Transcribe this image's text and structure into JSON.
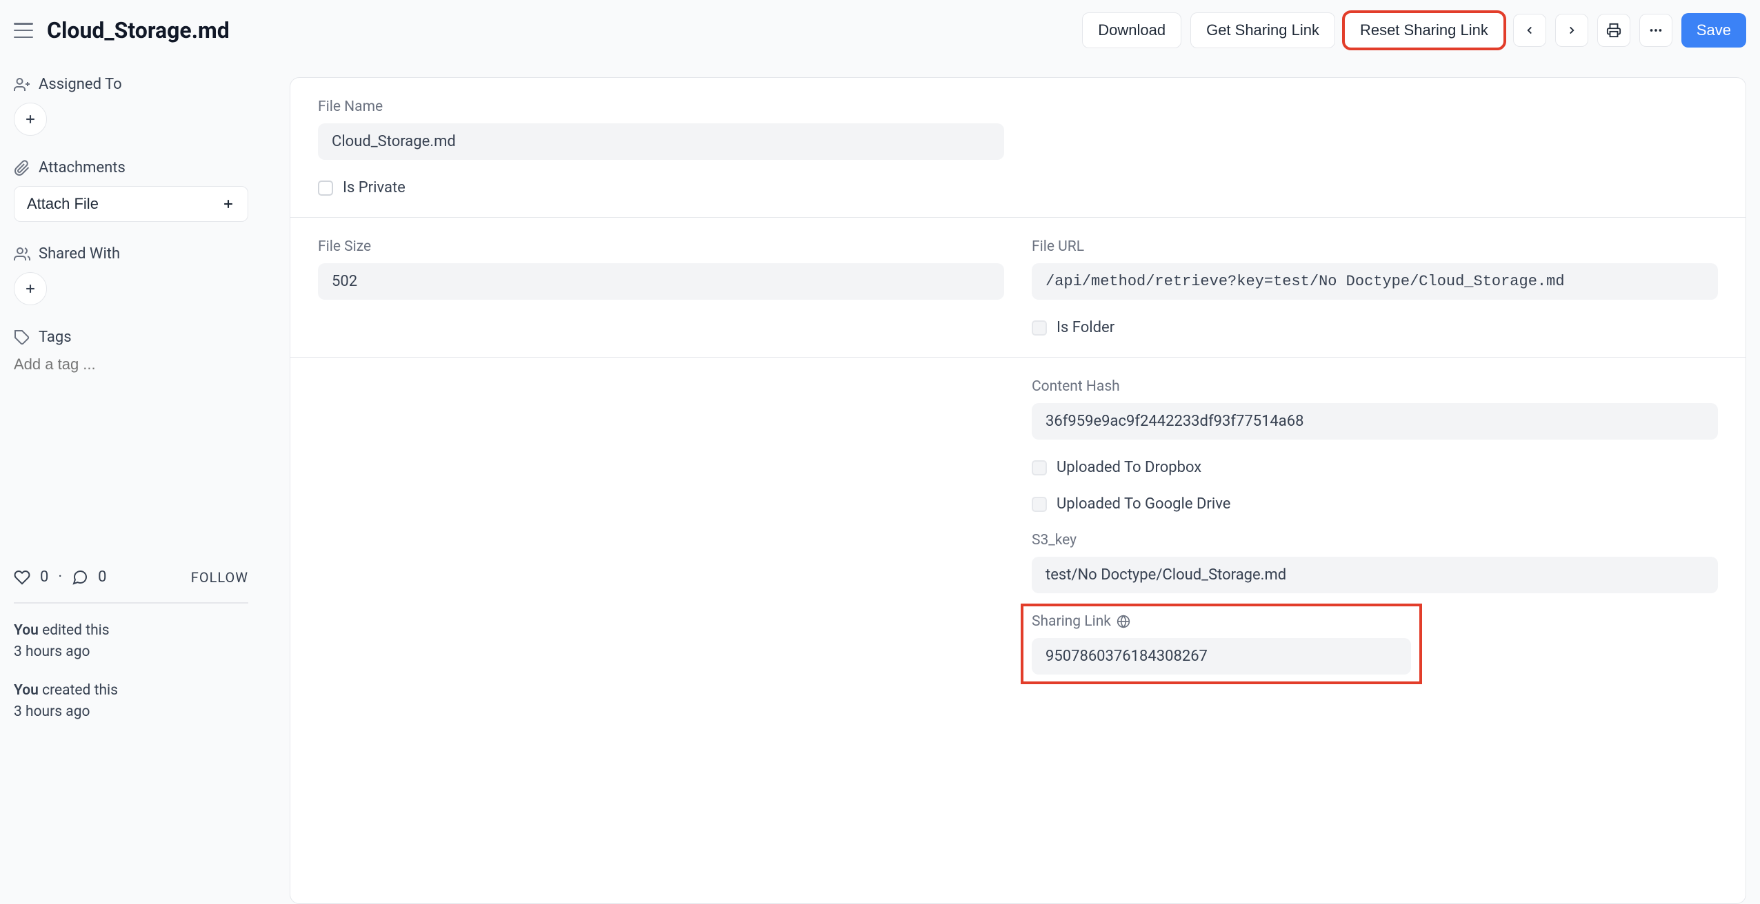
{
  "header": {
    "title": "Cloud_Storage.md",
    "buttons": {
      "download": "Download",
      "get_link": "Get Sharing Link",
      "reset_link": "Reset Sharing Link",
      "save": "Save"
    }
  },
  "sidebar": {
    "assigned_to": "Assigned To",
    "attachments": "Attachments",
    "attach_file": "Attach File",
    "shared_with": "Shared With",
    "tags": "Tags",
    "tag_placeholder": "Add a tag ...",
    "likes": "0",
    "comments": "0",
    "follow": "FOLLOW",
    "activity": [
      {
        "who": "You",
        "action": "edited this",
        "when": "3 hours ago"
      },
      {
        "who": "You",
        "action": "created this",
        "when": "3 hours ago"
      }
    ]
  },
  "form": {
    "file_name_label": "File Name",
    "file_name": "Cloud_Storage.md",
    "is_private_label": "Is Private",
    "file_size_label": "File Size",
    "file_size": "502",
    "file_url_label": "File URL",
    "file_url": "/api/method/retrieve?key=test/No Doctype/Cloud_Storage.md",
    "is_folder_label": "Is Folder",
    "content_hash_label": "Content Hash",
    "content_hash": "36f959e9ac9f2442233df93f77514a68",
    "uploaded_dropbox_label": "Uploaded To Dropbox",
    "uploaded_gdrive_label": "Uploaded To Google Drive",
    "s3_key_label": "S3_key",
    "s3_key": "test/No Doctype/Cloud_Storage.md",
    "sharing_link_label": "Sharing Link",
    "sharing_link": "9507860376184308267"
  }
}
